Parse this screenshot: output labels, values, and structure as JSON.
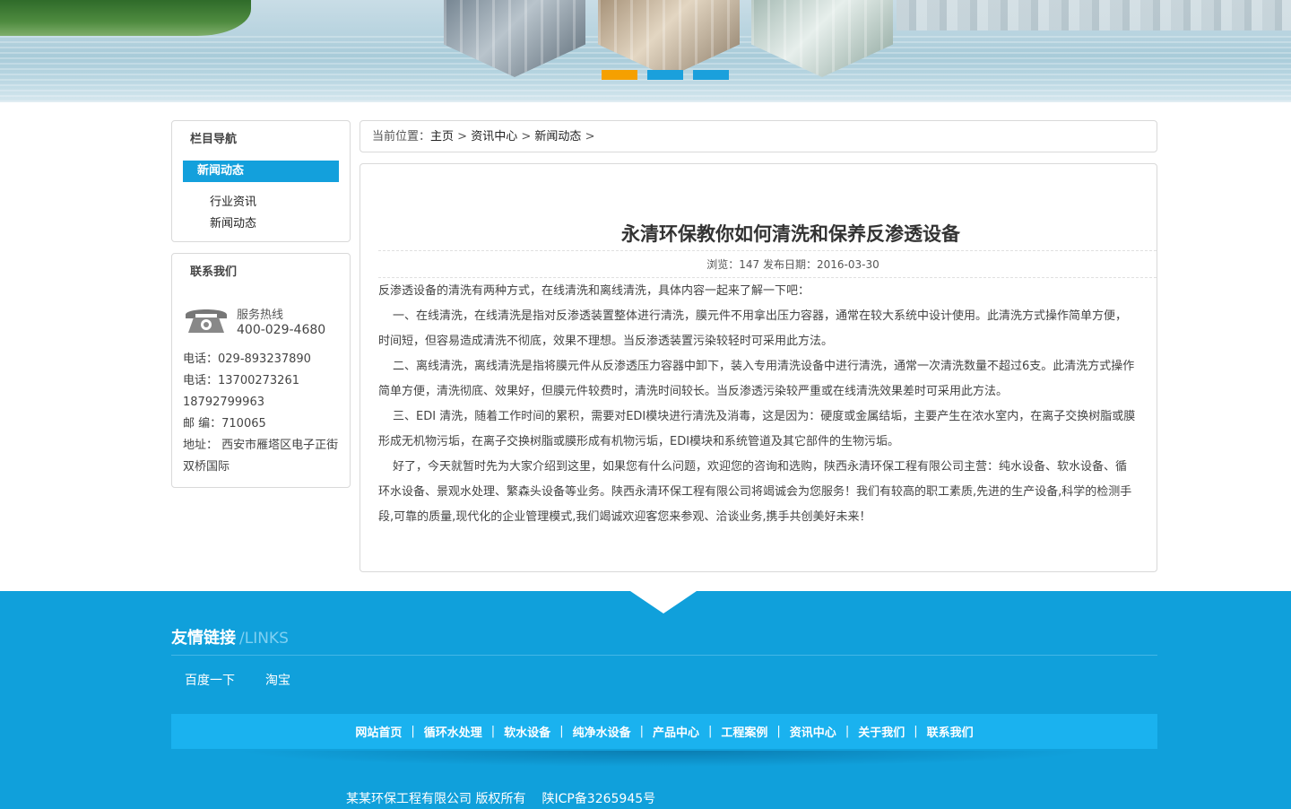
{
  "banner": {
    "slides": 3,
    "active_slide": 1
  },
  "sidebar": {
    "nav_title": "栏目导航",
    "current": "新闻动态",
    "items": [
      "行业资讯",
      "新闻动态"
    ],
    "contact_title": "联系我们",
    "hotline_label": "服务热线",
    "hotline_number": "400-029-4680",
    "tel": "电话：029-893237890",
    "mobile": "电话：13700273261",
    "mobile2": "18792799963",
    "postcode": "邮 编：710065",
    "address": "地址： 西安市雁塔区电子正街双桥国际"
  },
  "breadcrumb": {
    "prefix": "当前位置：",
    "home": "主页",
    "sep": ">",
    "level1": "资讯中心",
    "level2": "新闻动态",
    "tail": ">"
  },
  "article": {
    "title": "永清环保教你如何清洗和保养反渗透设备",
    "meta": "浏览：147 发布日期：2016-03-30",
    "paragraphs": [
      "反渗透设备的清洗有两种方式，在线清洗和离线清洗，具体内容一起来了解一下吧：",
      "一、在线清洗，在线清洗是指对反渗透装置整体进行清洗，膜元件不用拿出压力容器，通常在较大系统中设计使用。此清洗方式操作简单方便，时间短，但容易造成清洗不彻底，效果不理想。当反渗透装置污染较轻时可采用此方法。",
      "二、离线清洗，离线清洗是指将膜元件从反渗透压力容器中卸下，装入专用清洗设备中进行清洗，通常一次清洗数量不超过6支。此清洗方式操作简单方便，清洗彻底、效果好，但膜元件较费时，清洗时间较长。当反渗透污染较严重或在线清洗效果差时可采用此方法。",
      "三、EDI 清洗，随着工作时间的累积，需要对EDI模块进行清洗及消毒，这是因为：硬度或金属结垢，主要产生在浓水室内，在离子交换树脂或膜形成无机物污垢，在离子交换树脂或膜形成有机物污垢，EDI模块和系统管道及其它部件的生物污垢。",
      "好了，今天就暂时先为大家介绍到这里，如果您有什么问题，欢迎您的咨询和选购，陕西永清环保工程有限公司主营：纯水设备、软水设备、循环水设备、景观水处理、繁森头设备等业务。陕西永清环保工程有限公司将竭诚会为您服务！我们有较高的职工素质,先进的生产设备,科学的检测手段,可靠的质量,现代化的企业管理模式,我们竭诚欢迎客您来参观、洽谈业务,携手共创美好未来！"
    ]
  },
  "footer": {
    "links_title": "友情链接",
    "links_title_en": "/LINKS",
    "friend_links": [
      "百度一下",
      "淘宝"
    ],
    "nav": [
      "网站首页",
      "循环水处理",
      "软水设备",
      "纯净水设备",
      "产品中心",
      "工程案例",
      "资讯中心",
      "关于我们",
      "联系我们"
    ],
    "nav_sep": "|",
    "copyright": "某某环保工程有限公司 版权所有",
    "icp": "陕ICP备3265945号"
  },
  "colors": {
    "primary_blue": "#10a0db",
    "nav_blue": "#1ab2ef",
    "active_dot": "#f5a000",
    "sidebar_active": "#13a0dc"
  }
}
